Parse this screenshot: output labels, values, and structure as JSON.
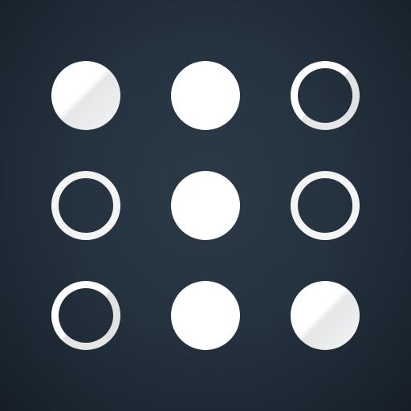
{
  "icon": {
    "name": "dot-pattern-app-icon",
    "background_colors": [
      "#2c3a48",
      "#1b2631"
    ],
    "foreground_color": "#ffffff"
  },
  "grid": {
    "rows": 3,
    "columns": 3,
    "cells": [
      {
        "state": "filled"
      },
      {
        "state": "filled"
      },
      {
        "state": "hollow"
      },
      {
        "state": "hollow"
      },
      {
        "state": "filled"
      },
      {
        "state": "hollow"
      },
      {
        "state": "hollow"
      },
      {
        "state": "filled"
      },
      {
        "state": "filled"
      }
    ]
  }
}
